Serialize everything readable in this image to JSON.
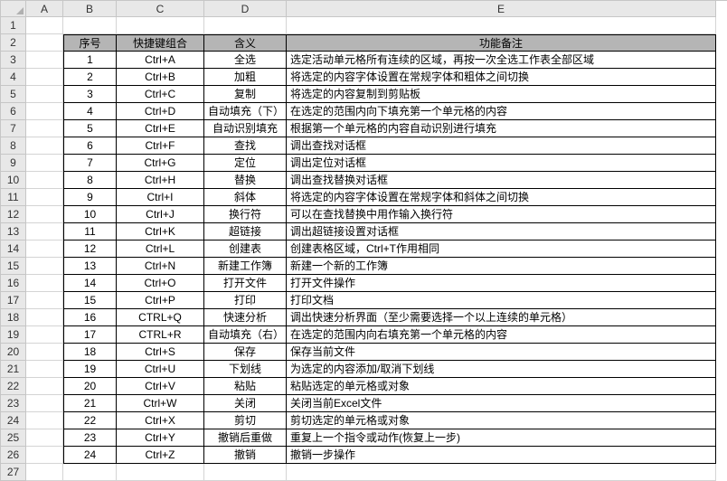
{
  "columns": [
    "A",
    "B",
    "C",
    "D",
    "E"
  ],
  "row_numbers": [
    1,
    2,
    3,
    4,
    5,
    6,
    7,
    8,
    9,
    10,
    11,
    12,
    13,
    14,
    15,
    16,
    17,
    18,
    19,
    20,
    21,
    22,
    23,
    24,
    25,
    26,
    27
  ],
  "table": {
    "headers": {
      "no": "序号",
      "combo": "快捷键组合",
      "meaning": "含义",
      "remark": "功能备注"
    },
    "rows": [
      {
        "no": "1",
        "combo": "Ctrl+A",
        "meaning": "全选",
        "remark": "选定活动单元格所有连续的区域，再按一次全选工作表全部区域"
      },
      {
        "no": "2",
        "combo": "Ctrl+B",
        "meaning": "加粗",
        "remark": "将选定的内容字体设置在常规字体和粗体之间切换"
      },
      {
        "no": "3",
        "combo": "Ctrl+C",
        "meaning": "复制",
        "remark": "将选定的内容复制到剪贴板"
      },
      {
        "no": "4",
        "combo": "Ctrl+D",
        "meaning": "自动填充（下）",
        "remark": "在选定的范围内向下填充第一个单元格的内容"
      },
      {
        "no": "5",
        "combo": "Ctrl+E",
        "meaning": "自动识别填充",
        "remark": "根据第一个单元格的内容自动识别进行填充"
      },
      {
        "no": "6",
        "combo": "Ctrl+F",
        "meaning": "查找",
        "remark": "调出查找对话框"
      },
      {
        "no": "7",
        "combo": "Ctrl+G",
        "meaning": "定位",
        "remark": "调出定位对话框"
      },
      {
        "no": "8",
        "combo": "Ctrl+H",
        "meaning": "替换",
        "remark": "调出查找替换对话框"
      },
      {
        "no": "9",
        "combo": "Ctrl+I",
        "meaning": "斜体",
        "remark": "将选定的内容字体设置在常规字体和斜体之间切换"
      },
      {
        "no": "10",
        "combo": "Ctrl+J",
        "meaning": "换行符",
        "remark": "可以在查找替换中用作输入换行符"
      },
      {
        "no": "11",
        "combo": "Ctrl+K",
        "meaning": "超链接",
        "remark": "调出超链接设置对话框"
      },
      {
        "no": "12",
        "combo": "Ctrl+L",
        "meaning": "创建表",
        "remark": "创建表格区域，Ctrl+T作用相同"
      },
      {
        "no": "13",
        "combo": "Ctrl+N",
        "meaning": "新建工作簿",
        "remark": "新建一个新的工作簿"
      },
      {
        "no": "14",
        "combo": "Ctrl+O",
        "meaning": "打开文件",
        "remark": "打开文件操作"
      },
      {
        "no": "15",
        "combo": "Ctrl+P",
        "meaning": "打印",
        "remark": "打印文档"
      },
      {
        "no": "16",
        "combo": "CTRL+Q",
        "meaning": "快速分析",
        "remark": "调出快速分析界面（至少需要选择一个以上连续的单元格）"
      },
      {
        "no": "17",
        "combo": "CTRL+R",
        "meaning": "自动填充（右）",
        "remark": "在选定的范围内向右填充第一个单元格的内容"
      },
      {
        "no": "18",
        "combo": "Ctrl+S",
        "meaning": "保存",
        "remark": "保存当前文件"
      },
      {
        "no": "19",
        "combo": "Ctrl+U",
        "meaning": "下划线",
        "remark": "为选定的内容添加/取消下划线"
      },
      {
        "no": "20",
        "combo": "Ctrl+V",
        "meaning": "粘贴",
        "remark": "粘贴选定的单元格或对象"
      },
      {
        "no": "21",
        "combo": "Ctrl+W",
        "meaning": "关闭",
        "remark": "关闭当前Excel文件"
      },
      {
        "no": "22",
        "combo": "Ctrl+X",
        "meaning": "剪切",
        "remark": "剪切选定的单元格或对象"
      },
      {
        "no": "23",
        "combo": "Ctrl+Y",
        "meaning": "撤销后重做",
        "remark": "重复上一个指令或动作(恢复上一步)"
      },
      {
        "no": "24",
        "combo": "Ctrl+Z",
        "meaning": "撤销",
        "remark": "撤销一步操作"
      }
    ]
  }
}
